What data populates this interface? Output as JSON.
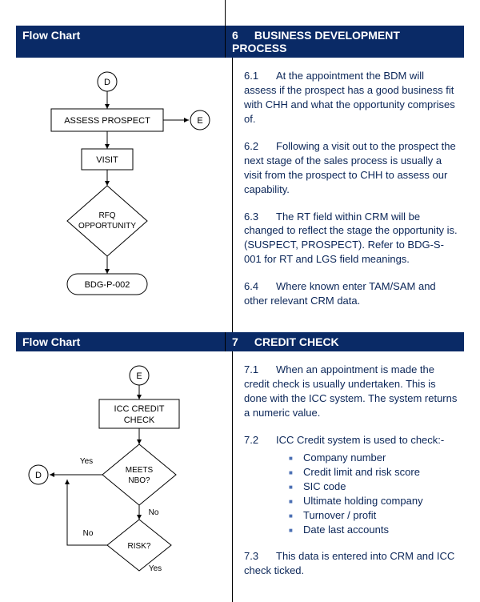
{
  "section6": {
    "leftHeader": "Flow Chart",
    "rightNumber": "6",
    "rightTitle": "BUSINESS DEVELOPMENT PROCESS",
    "flowchart": {
      "nodeD": "D",
      "assess": "ASSESS PROSPECT",
      "nodeE": "E",
      "visit": "VISIT",
      "rfq1": "RFQ",
      "rfq2": "OPPORTUNITY",
      "bdg": "BDG-P-002"
    },
    "paragraphs": [
      {
        "num": "6.1",
        "text": "At the appointment the BDM will assess if the prospect has a good business fit with CHH and what the opportunity comprises of."
      },
      {
        "num": "6.2",
        "text": "Following a visit out to the prospect the next stage of the sales process is usually a visit from the prospect to CHH to assess our capability."
      },
      {
        "num": "6.3",
        "text": "The RT field within CRM will be changed to reflect the stage the opportunity is. (SUSPECT, PROSPECT). Refer to BDG-S-001 for RT and LGS field meanings."
      },
      {
        "num": "6.4",
        "text": "Where known enter TAM/SAM and other relevant CRM data."
      }
    ]
  },
  "section7": {
    "leftHeader": "Flow Chart",
    "rightNumber": "7",
    "rightTitle": "CREDIT CHECK",
    "flowchart": {
      "nodeE": "E",
      "icc1": "ICC CREDIT",
      "icc2": "CHECK",
      "meets1": "MEETS",
      "meets2": "NBO?",
      "yes": "Yes",
      "no": "No",
      "nodeD": "D",
      "risk": "RISK?",
      "yes2": "Yes",
      "no2": "No"
    },
    "para71": {
      "num": "7.1",
      "text": "When an appointment is made the credit check is usually undertaken.  This is done with the ICC system.  The system returns a numeric value."
    },
    "para72": {
      "num": "7.2",
      "text": "ICC Credit system is used to check:-"
    },
    "bullets": [
      "Company number",
      "Credit limit and risk score",
      "SIC code",
      "Ultimate holding company",
      "Turnover / profit",
      "Date last accounts"
    ],
    "para73": {
      "num": "7.3",
      "text": "This data is entered into CRM and ICC check ticked."
    }
  }
}
